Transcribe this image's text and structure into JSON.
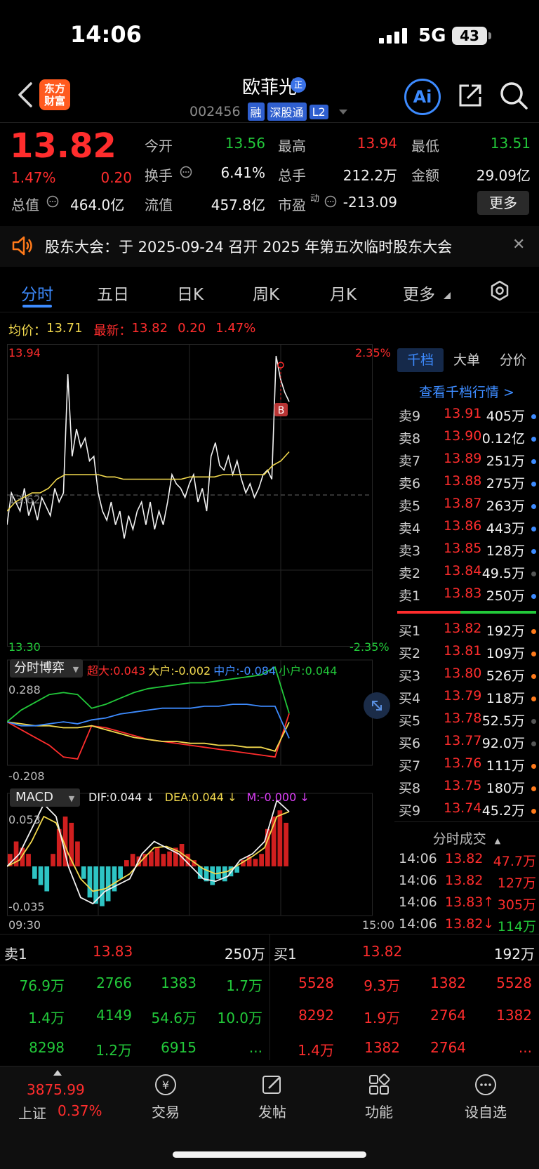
{
  "status": {
    "time": "14:06",
    "network": "5G",
    "battery": "43"
  },
  "header": {
    "logo_text": "东方财富",
    "name": "欧菲光",
    "name_badge": "正",
    "code": "002456",
    "tags": [
      "融",
      "深股通",
      "L2"
    ],
    "ai_label": "Ai"
  },
  "quote": {
    "price": "13.82",
    "pct": "1.47%",
    "change": "0.20",
    "fields": [
      {
        "label": "今开",
        "value": "13.56",
        "color": "green"
      },
      {
        "label": "最高",
        "value": "13.94",
        "color": "red"
      },
      {
        "label": "最低",
        "value": "13.51",
        "color": "green"
      },
      {
        "label": "换手",
        "value": "6.41%",
        "color": "white"
      },
      {
        "label": "总手",
        "value": "212.2万",
        "color": "white"
      },
      {
        "label": "金额",
        "value": "29.09亿",
        "color": "white"
      },
      {
        "label": "流值",
        "value": "457.8亿",
        "color": "white"
      },
      {
        "label": "市盈",
        "value": "-213.09",
        "color": "white"
      }
    ],
    "market_cap_label": "总值",
    "market_cap": "464.0亿",
    "pe_superscript": "动",
    "more_label": "更多"
  },
  "notice": {
    "text": "股东大会：于 2025-09-24 召开 2025 年第五次临时股东大会"
  },
  "tabs": [
    "分时",
    "五日",
    "日K",
    "周K",
    "月K",
    "更多"
  ],
  "avg_row": {
    "avg_label": "均价：",
    "avg_value": "13.71",
    "latest_label": "最新：",
    "latest_value": "13.82",
    "change": "0.20",
    "pct": "1.47%"
  },
  "chart_labels": {
    "price_high": "13.94",
    "price_low": "13.30",
    "pct_high": "2.35%",
    "pct_low": "-2.35%",
    "ref_price": "13.62",
    "game_title": "分时博弈",
    "game_big": "超大:0.043",
    "game_large": "大户:-0.002",
    "game_mid": "中户:-0.084",
    "game_small": "小户:0.044",
    "game_max": "0.288",
    "game_min": "-0.208",
    "macd_title": "MACD",
    "dif": "DIF:0.044 ↓",
    "dea": "DEA:0.044 ↓",
    "m": "M:-0.000 ↓",
    "macd_max": "0.053",
    "macd_min": "-0.035",
    "time_start": "09:30",
    "time_end": "15:00",
    "buy_marker": "B"
  },
  "colors": {
    "up": "#ff2d2d",
    "down": "#22c93a",
    "avg": "#f2d94e",
    "accent": "#3d8bff"
  },
  "order_book": {
    "tabs": [
      "千档",
      "大单",
      "分价"
    ],
    "link": "查看千档行情 >",
    "asks": [
      {
        "label": "卖9",
        "price": "13.91",
        "vol": "405万",
        "dot": "#3d8bff"
      },
      {
        "label": "卖8",
        "price": "13.90",
        "vol": "0.12亿",
        "dot": "#3d8bff"
      },
      {
        "label": "卖7",
        "price": "13.89",
        "vol": "251万",
        "dot": "#3d8bff"
      },
      {
        "label": "卖6",
        "price": "13.88",
        "vol": "275万",
        "dot": "#3d8bff"
      },
      {
        "label": "卖5",
        "price": "13.87",
        "vol": "263万",
        "dot": "#3d8bff"
      },
      {
        "label": "卖4",
        "price": "13.86",
        "vol": "443万",
        "dot": "#3d8bff"
      },
      {
        "label": "卖3",
        "price": "13.85",
        "vol": "128万",
        "dot": "#3d8bff"
      },
      {
        "label": "卖2",
        "price": "13.84",
        "vol": "49.5万",
        "dot": "#555555"
      },
      {
        "label": "卖1",
        "price": "13.83",
        "vol": "250万",
        "dot": "#3d8bff"
      }
    ],
    "bids": [
      {
        "label": "买1",
        "price": "13.82",
        "vol": "192万",
        "dot": "#ff7a1a"
      },
      {
        "label": "买2",
        "price": "13.81",
        "vol": "109万",
        "dot": "#ff7a1a"
      },
      {
        "label": "买3",
        "price": "13.80",
        "vol": "526万",
        "dot": "#ff7a1a"
      },
      {
        "label": "买4",
        "price": "13.79",
        "vol": "118万",
        "dot": "#ff7a1a"
      },
      {
        "label": "买5",
        "price": "13.78",
        "vol": "52.5万",
        "dot": "#555555"
      },
      {
        "label": "买6",
        "price": "13.77",
        "vol": "92.0万",
        "dot": "#555555"
      },
      {
        "label": "买7",
        "price": "13.76",
        "vol": "111万",
        "dot": "#ff7a1a"
      },
      {
        "label": "买8",
        "price": "13.75",
        "vol": "180万",
        "dot": "#ff7a1a"
      },
      {
        "label": "买9",
        "price": "13.74",
        "vol": "45.2万",
        "dot": "#ff7a1a"
      }
    ],
    "ticks_title": "分时成交",
    "ticks": [
      {
        "time": "14:06",
        "price": "13.82",
        "vol": "47.7万",
        "vol_color": "red"
      },
      {
        "time": "14:06",
        "price": "13.82",
        "vol": "127万",
        "vol_color": "red"
      },
      {
        "time": "14:06",
        "price": "13.83↑",
        "vol": "305万",
        "vol_color": "red"
      },
      {
        "time": "14:06",
        "price": "13.82↓",
        "vol": "114万",
        "vol_color": "green"
      }
    ]
  },
  "queues": {
    "ask_label": "卖1",
    "ask_price": "13.83",
    "ask_vol": "250万",
    "bid_label": "买1",
    "bid_price": "13.82",
    "bid_vol": "192万",
    "ask_cells": [
      "76.9万",
      "2766",
      "1383",
      "1.7万",
      "1.4万",
      "4149",
      "54.6万",
      "10.0万",
      "8298",
      "1.2万",
      "6915",
      "..."
    ],
    "bid_cells": [
      "5528",
      "9.3万",
      "1382",
      "5528",
      "8292",
      "1.9万",
      "2764",
      "1382",
      "1.4万",
      "1382",
      "2764",
      "..."
    ]
  },
  "nav": {
    "index_value": "3875.99",
    "index_name": "上证",
    "index_pct": "0.37%",
    "items": [
      "交易",
      "发帖",
      "功能",
      "设自选"
    ]
  },
  "chart_data": [
    {
      "type": "line",
      "title": "分时",
      "x_range": [
        "09:30",
        "15:00"
      ],
      "ylim": [
        13.3,
        13.94
      ],
      "series": [
        {
          "name": "最新",
          "values": [
            13.55,
            13.62,
            13.6,
            13.58,
            13.63,
            13.57,
            13.6,
            13.56,
            13.61,
            13.59,
            13.57,
            13.63,
            13.6,
            13.62,
            13.88,
            13.7,
            13.76,
            13.72,
            13.74,
            13.69,
            13.7,
            13.62,
            13.58,
            13.56,
            13.6,
            13.55,
            13.58,
            13.52,
            13.57,
            13.54,
            13.58,
            13.6,
            13.55,
            13.6,
            13.54,
            13.58,
            13.55,
            13.6,
            13.66,
            13.64,
            13.63,
            13.61,
            13.64,
            13.66,
            13.6,
            13.63,
            13.58,
            13.7,
            13.73,
            13.68,
            13.67,
            13.7,
            13.66,
            13.69,
            13.65,
            13.62,
            13.64,
            13.61,
            13.63,
            13.66,
            13.67,
            13.65,
            13.92,
            13.87,
            13.84,
            13.82
          ]
        },
        {
          "name": "均价",
          "values": [
            13.58,
            13.6,
            13.61,
            13.62,
            13.62,
            13.63,
            13.65,
            13.66,
            13.66,
            13.66,
            13.66,
            13.66,
            13.655,
            13.655,
            13.65,
            13.65,
            13.65,
            13.65,
            13.65,
            13.65,
            13.65,
            13.65,
            13.655,
            13.655,
            13.655,
            13.655,
            13.66,
            13.66,
            13.66,
            13.66,
            13.66,
            13.66,
            13.68,
            13.69,
            13.71
          ]
        }
      ]
    },
    {
      "type": "line",
      "title": "分时博弈",
      "ylim": [
        -0.208,
        0.288
      ],
      "series": [
        {
          "name": "超大",
          "values": [
            0.0,
            -0.04,
            -0.08,
            -0.12,
            -0.18,
            -0.19,
            -0.02,
            -0.03,
            -0.05,
            -0.07,
            -0.09,
            -0.1,
            -0.11,
            -0.12,
            -0.13,
            -0.14,
            -0.15,
            -0.16,
            -0.17,
            -0.18,
            0.043
          ]
        },
        {
          "name": "大户",
          "values": [
            0.0,
            -0.01,
            -0.02,
            -0.02,
            -0.03,
            -0.03,
            -0.02,
            -0.04,
            -0.06,
            -0.08,
            -0.09,
            -0.1,
            -0.1,
            -0.11,
            -0.11,
            -0.12,
            -0.12,
            -0.13,
            -0.13,
            -0.15,
            -0.002
          ]
        },
        {
          "name": "中户",
          "values": [
            0.0,
            -0.02,
            -0.02,
            -0.01,
            0.0,
            -0.01,
            0.01,
            0.02,
            0.04,
            0.05,
            0.06,
            0.07,
            0.07,
            0.07,
            0.08,
            0.08,
            0.09,
            0.09,
            0.08,
            0.08,
            -0.084
          ]
        },
        {
          "name": "小户",
          "values": [
            0.0,
            0.06,
            0.1,
            0.14,
            0.15,
            0.14,
            0.07,
            0.09,
            0.12,
            0.15,
            0.17,
            0.18,
            0.19,
            0.2,
            0.2,
            0.21,
            0.22,
            0.23,
            0.24,
            0.28,
            0.044
          ]
        }
      ]
    },
    {
      "type": "bar",
      "title": "MACD",
      "ylim": [
        -0.035,
        0.053
      ],
      "series": [
        {
          "name": "M",
          "values": [
            0.01,
            0.02,
            0.015,
            0.01,
            -0.01,
            -0.015,
            -0.02,
            0.01,
            0.03,
            0.04,
            0.035,
            0.02,
            -0.01,
            -0.025,
            -0.03,
            -0.032,
            -0.028,
            -0.02,
            -0.01,
            0.005,
            0.01,
            0.008,
            0.01,
            0.012,
            0.015,
            0.01,
            0.012,
            0.015,
            0.018,
            0.01,
            0.005,
            -0.01,
            -0.012,
            -0.015,
            -0.01,
            -0.012,
            -0.008,
            -0.005,
            0.005,
            0.008,
            0.006,
            0.01,
            0.03,
            0.04,
            0.045,
            0.035
          ]
        },
        {
          "name": "DIF",
          "values": [
            0.0,
            0.01,
            0.03,
            0.05,
            0.04,
            0.0,
            -0.025,
            -0.03,
            -0.02,
            -0.015,
            -0.01,
            0.01,
            0.02,
            0.015,
            0.01,
            0.0,
            -0.01,
            -0.012,
            -0.008,
            0.005,
            0.01,
            0.02,
            0.053,
            0.044
          ]
        },
        {
          "name": "DEA",
          "values": [
            0.0,
            0.005,
            0.02,
            0.04,
            0.035,
            0.01,
            -0.01,
            -0.02,
            -0.018,
            -0.012,
            -0.006,
            0.005,
            0.015,
            0.016,
            0.012,
            0.005,
            -0.002,
            -0.006,
            -0.004,
            0.002,
            0.008,
            0.015,
            0.04,
            0.044
          ]
        }
      ]
    }
  ]
}
